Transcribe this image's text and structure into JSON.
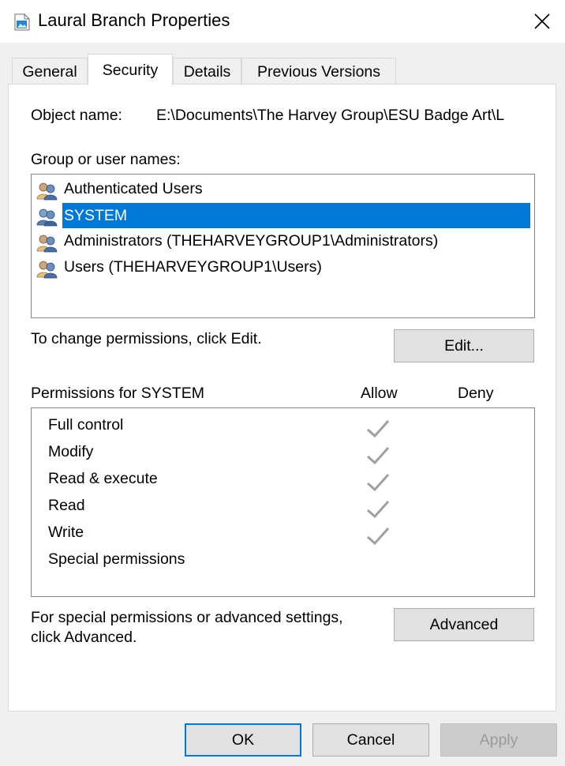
{
  "window": {
    "title": "Laural Branch Properties"
  },
  "tabs": [
    {
      "label": "General"
    },
    {
      "label": "Security"
    },
    {
      "label": "Details"
    },
    {
      "label": "Previous Versions"
    }
  ],
  "active_tab": "Security",
  "object": {
    "label": "Object name:",
    "value": "E:\\Documents\\The Harvey Group\\ESU Badge Art\\L"
  },
  "groups": {
    "label": "Group or user names:",
    "items": [
      {
        "name": "Authenticated Users",
        "icon": "users-icon"
      },
      {
        "name": "SYSTEM",
        "icon": "users-icon",
        "selected": true
      },
      {
        "name": "Administrators (THEHARVEYGROUP1\\Administrators)",
        "icon": "users-icon"
      },
      {
        "name": "Users (THEHARVEYGROUP1\\Users)",
        "icon": "users-icon"
      }
    ]
  },
  "change_text": "To change permissions, click Edit.",
  "edit_button": "Edit...",
  "permissions": {
    "label": "Permissions for SYSTEM",
    "allow_header": "Allow",
    "deny_header": "Deny",
    "rows": [
      {
        "name": "Full control",
        "allow": true,
        "deny": false
      },
      {
        "name": "Modify",
        "allow": true,
        "deny": false
      },
      {
        "name": "Read & execute",
        "allow": true,
        "deny": false
      },
      {
        "name": "Read",
        "allow": true,
        "deny": false
      },
      {
        "name": "Write",
        "allow": true,
        "deny": false
      },
      {
        "name": "Special permissions",
        "allow": false,
        "deny": false
      }
    ]
  },
  "advanced": {
    "text_line1": "For special permissions or advanced settings,",
    "text_line2": "click Advanced.",
    "button": "Advanced"
  },
  "footer": {
    "ok": "OK",
    "cancel": "Cancel",
    "apply": "Apply"
  },
  "colors": {
    "selection": "#0078d7",
    "check": "#a0a0a0",
    "disabled_text": "#9a9a9a"
  }
}
